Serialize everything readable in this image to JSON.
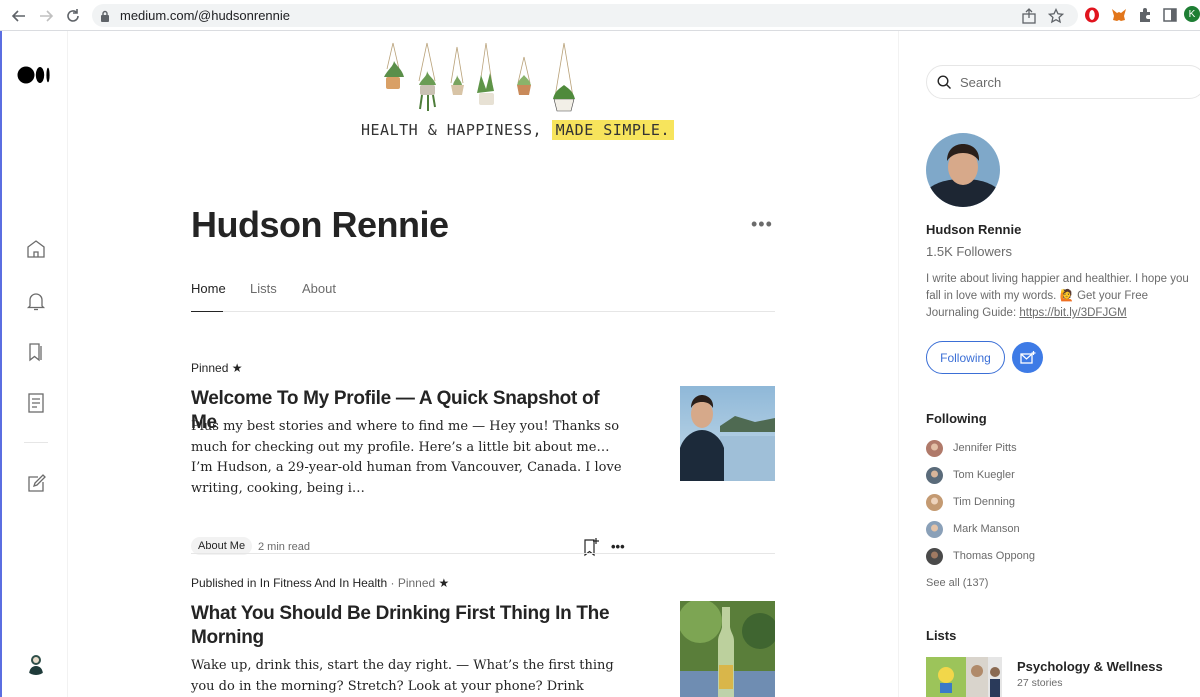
{
  "browser": {
    "url": "medium.com/@hudsonrennie",
    "profile_initial": "K"
  },
  "banner": {
    "text_plain": "HEALTH & HAPPINESS,",
    "text_highlight": "MADE SIMPLE."
  },
  "profile": {
    "name": "Hudson Rennie",
    "more_label": "•••",
    "tabs": [
      {
        "label": "Home",
        "active": true
      },
      {
        "label": "Lists",
        "active": false
      },
      {
        "label": "About",
        "active": false
      }
    ]
  },
  "articles": [
    {
      "pinned_label": "Pinned",
      "star": "★",
      "title": "Welcome To My Profile — A Quick Snapshot of Me",
      "excerpt": "Plus my best stories and where to find me — Hey you! Thanks so much for checking out my profile. Here’s a little bit about me… I’m Hudson, a 29-year-old human from Vancouver, Canada. I love writing, cooking, being i…",
      "tag": "About Me",
      "read_time": "2 min read",
      "more_label": "•••"
    },
    {
      "published_prefix": "Published in",
      "publication": "In Fitness And In Health",
      "pinned_label": "· Pinned",
      "star": "★",
      "title": "What You Should Be Drinking First Thing In The Morning",
      "excerpt": "Wake up, drink this, start the day right. — What’s the first thing you do in the morning? Stretch? Look at your phone? Drink water? The first thing…"
    }
  ],
  "sidebar": {
    "search_placeholder": "Search",
    "name": "Hudson Rennie",
    "followers": "1.5K Followers",
    "bio": "I write about living happier and healthier. I hope you fall in love with my words. 🙋 Get your Free Journaling Guide:",
    "bio_link": "https://bit.ly/3DFJGM",
    "following_button": "Following",
    "following_heading": "Following",
    "following": [
      {
        "name": "Jennifer Pitts",
        "color": "#b07a6a"
      },
      {
        "name": "Tom Kuegler",
        "color": "#5a6b7a"
      },
      {
        "name": "Tim Denning",
        "color": "#c49a72"
      },
      {
        "name": "Mark Manson",
        "color": "#8aa0b8"
      },
      {
        "name": "Thomas Oppong",
        "color": "#4a4a4a"
      }
    ],
    "see_all": "See all (137)",
    "lists_heading": "Lists",
    "list": {
      "title": "Psychology & Wellness",
      "count": "27 stories"
    }
  },
  "colors": {
    "accent_blue": "#3e7be6",
    "banner_highlight": "#f7e45c",
    "text_primary": "#242424",
    "text_muted": "#6b6b6b"
  }
}
